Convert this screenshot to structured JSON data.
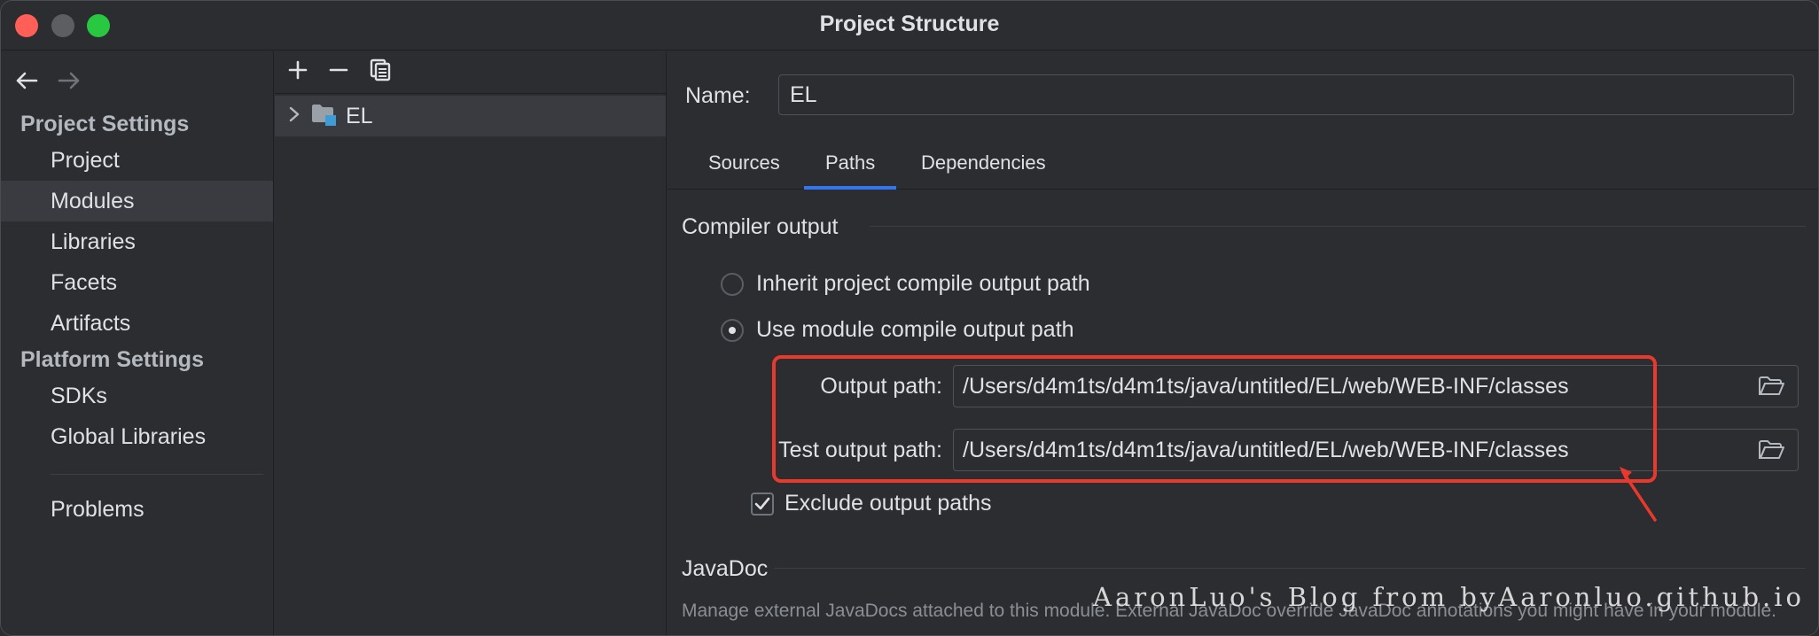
{
  "window": {
    "title": "Project Structure"
  },
  "nav": {
    "project_settings_heading": "Project Settings",
    "project_items": [
      {
        "label": "Project"
      },
      {
        "label": "Modules",
        "selected": true
      },
      {
        "label": "Libraries"
      },
      {
        "label": "Facets"
      },
      {
        "label": "Artifacts"
      }
    ],
    "platform_settings_heading": "Platform Settings",
    "platform_items": [
      {
        "label": "SDKs"
      },
      {
        "label": "Global Libraries"
      }
    ],
    "problems_label": "Problems"
  },
  "tree": {
    "toolbar": {
      "add_icon": "plus-icon",
      "remove_icon": "minus-icon",
      "copy_icon": "copy-icon"
    },
    "module_name": "EL"
  },
  "main": {
    "name_label": "Name:",
    "name_value": "EL",
    "tabs": [
      {
        "label": "Sources"
      },
      {
        "label": "Paths",
        "active": true
      },
      {
        "label": "Dependencies"
      }
    ],
    "compiler_output": {
      "title": "Compiler output",
      "inherit_label": "Inherit project compile output path",
      "use_module_label": "Use module compile output path",
      "selected_option": "use_module",
      "output_path_label": "Output path:",
      "output_path_value": "/Users/d4m1ts/d4m1ts/java/untitled/EL/web/WEB-INF/classes",
      "test_output_path_label": "Test output path:",
      "test_output_path_value": "/Users/d4m1ts/d4m1ts/java/untitled/EL/web/WEB-INF/classes",
      "exclude_label": "Exclude output paths",
      "exclude_checked": true
    },
    "javadoc": {
      "title": "JavaDoc",
      "description": "Manage external JavaDocs attached to this module. External JavaDoc override JavaDoc annotations you might have in your module."
    }
  },
  "watermark": "AaronLuo's Blog from byAaronluo.github.io",
  "colors": {
    "accent": "#3574f0",
    "annotation": "#e8392c",
    "background": "#2b2d30",
    "selected": "#393b40"
  }
}
